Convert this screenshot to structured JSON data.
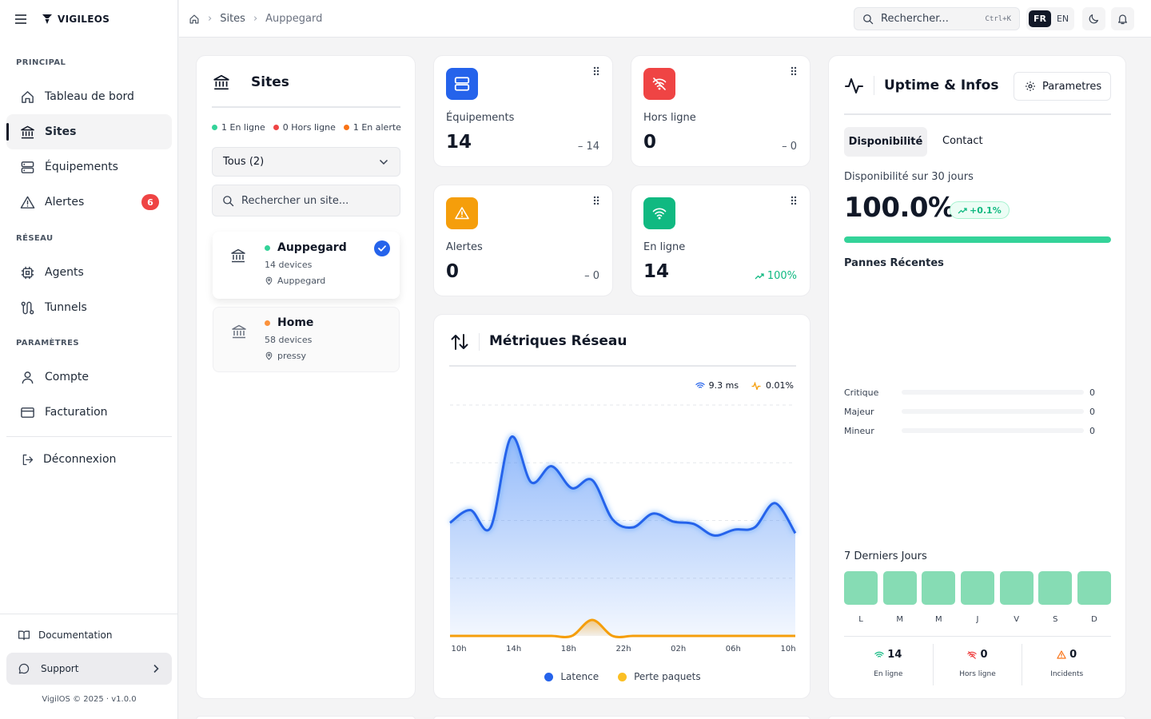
{
  "brand": {
    "name": "VIGILEOS"
  },
  "breadcrumb": {
    "home": "home",
    "sites": "Sites",
    "current": "Auppegard"
  },
  "topbar": {
    "search_placeholder": "Rechercher...",
    "shortcut": "Ctrl+K",
    "lang_fr": "FR",
    "lang_en": "EN"
  },
  "sidebar": {
    "principal": "PRINCIPAL",
    "reseau": "RÉSEAU",
    "parametres": "PARAMÈTRES",
    "items": {
      "dashboard": "Tableau de bord",
      "sites": "Sites",
      "equipements": "Équipements",
      "alertes": "Alertes",
      "alertes_badge": "6",
      "agents": "Agents",
      "tunnels": "Tunnels",
      "compte": "Compte",
      "facturation": "Facturation"
    },
    "logout": "Déconnexion",
    "documentation": "Documentation",
    "support": "Support",
    "footer": "VigilOS © 2025 · v1.0.0"
  },
  "sites_panel": {
    "title": "Sites",
    "legend_online": "1 En ligne",
    "legend_offline": "0 Hors ligne",
    "legend_alert": "1 En alerte",
    "filter": "Tous (2)",
    "search_placeholder": "Rechercher un site...",
    "sites": [
      {
        "name": "Auppegard",
        "devices": "14 devices",
        "location": "Auppegard",
        "status_color": "#34d399"
      },
      {
        "name": "Home",
        "devices": "58 devices",
        "location": "pressy",
        "status_color": "#fb923c"
      }
    ]
  },
  "stats": {
    "equipements": {
      "label": "Équipements",
      "value": "14",
      "delta": "– 14",
      "color": "#2563eb"
    },
    "hors_ligne": {
      "label": "Hors ligne",
      "value": "0",
      "delta": "– 0",
      "color": "#ef4444"
    },
    "alertes": {
      "label": "Alertes",
      "value": "0",
      "delta": "– 0",
      "color": "#f59e0b"
    },
    "en_ligne": {
      "label": "En ligne",
      "value": "14",
      "delta": "100%",
      "color": "#10b981"
    }
  },
  "metrics": {
    "title": "Métriques Réseau",
    "latency_value": "9.3 ms",
    "loss_value": "0.01%",
    "legend_latency": "Latence",
    "legend_loss": "Perte paquets",
    "x_labels": [
      "10h",
      "14h",
      "18h",
      "22h",
      "02h",
      "06h",
      "10h"
    ]
  },
  "chart_data": {
    "type": "area",
    "title": "Métriques Réseau",
    "categories": [
      "10h",
      "14h",
      "18h",
      "22h",
      "02h",
      "06h",
      "10h"
    ],
    "series": [
      {
        "name": "Latence",
        "color": "#2563eb",
        "values": [
          9.8,
          10.9,
          9.4,
          17.2,
          13.3,
          14.7,
          12.8,
          13.5,
          10.1,
          9.4,
          10.6,
          9.9,
          9.7,
          8.7,
          9.2,
          9.4,
          11.5,
          8.9
        ]
      },
      {
        "name": "Perte paquets",
        "color": "#f59e0b",
        "values": [
          0,
          0,
          0,
          0,
          0,
          0,
          0,
          1,
          0,
          0,
          0,
          0,
          0,
          0,
          0,
          0,
          0,
          0
        ]
      }
    ],
    "grid": true,
    "legend": "bottom"
  },
  "uptime": {
    "title": "Uptime & Infos",
    "settings_btn": "Parametres",
    "tab_disponibilite": "Disponibilité",
    "tab_contact": "Contact",
    "subtitle": "Disponibilité sur 30 jours",
    "value": "100.0%",
    "trend": "+0.1%",
    "progress": 1.0,
    "pannes_title": "Pannes Récentes",
    "severities": [
      {
        "label": "Critique",
        "count": "0"
      },
      {
        "label": "Majeur",
        "count": "0"
      },
      {
        "label": "Mineur",
        "count": "0"
      }
    ],
    "days_title": "7 Derniers Jours",
    "days": [
      "L",
      "M",
      "M",
      "J",
      "V",
      "S",
      "D"
    ],
    "summary": [
      {
        "value": "14",
        "label": "En ligne"
      },
      {
        "value": "0",
        "label": "Hors ligne"
      },
      {
        "value": "0",
        "label": "Incidents"
      }
    ]
  }
}
